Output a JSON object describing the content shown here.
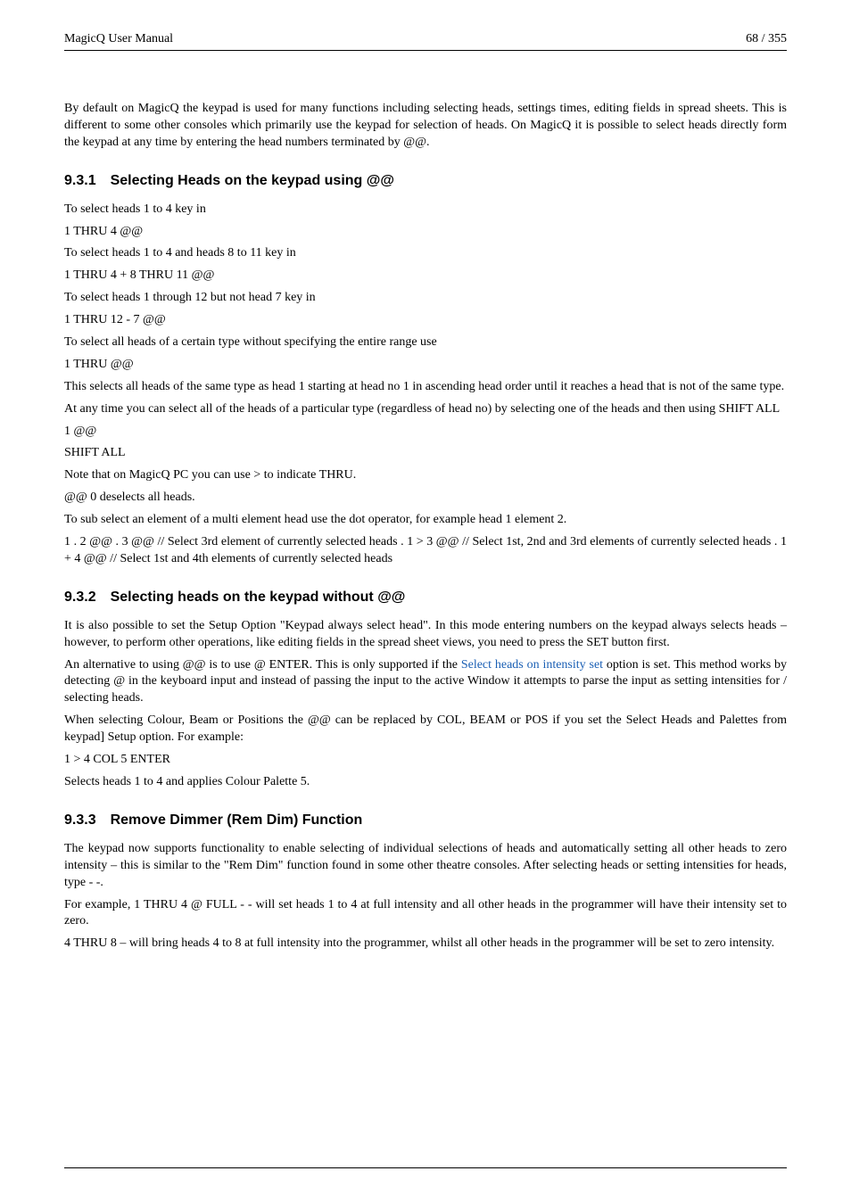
{
  "header": {
    "left": "MagicQ User Manual",
    "right": "68 / 355"
  },
  "intro": "By default on MagicQ the keypad is used for many functions including selecting heads, settings times, editing fields in spread sheets. This is different to some other consoles which primarily use the keypad for selection of heads. On MagicQ it is possible to select heads directly form the keypad at any time by entering the head numbers terminated by @@.",
  "s931": {
    "heading": "9.3.1 Selecting Heads on the keypad using @@",
    "p1": "To select heads 1 to 4 key in",
    "p2": "1 THRU 4 @@",
    "p3": "To select heads 1 to 4 and heads 8 to 11 key in",
    "p4": "1 THRU 4 + 8 THRU 11 @@",
    "p5": "To select heads 1 through 12 but not head 7 key in",
    "p6": "1 THRU 12 - 7 @@",
    "p7": "To select all heads of a certain type without specifying the entire range use",
    "p8": "1 THRU @@",
    "p9": "This selects all heads of the same type as head 1 starting at head no 1 in ascending head order until it reaches a head that is not of the same type.",
    "p10": "At any time you can select all of the heads of a particular type (regardless of head no) by selecting one of the heads and then using SHIFT ALL",
    "p11": "1 @@",
    "p12": "SHIFT ALL",
    "p13": "Note that on MagicQ PC you can use > to indicate THRU.",
    "p14": "@@ 0 deselects all heads.",
    "p15": "To sub select an element of a multi element head use the dot operator, for example head 1 element 2.",
    "p16": "1 . 2 @@ . 3 @@ // Select 3rd element of currently selected heads . 1 > 3 @@ // Select 1st, 2nd and 3rd elements of currently selected heads . 1 + 4 @@ // Select 1st and 4th elements of currently selected heads"
  },
  "s932": {
    "heading": "9.3.2 Selecting heads on the keypad without @@",
    "p1": "It is also possible to set the Setup Option \"Keypad always select head\". In this mode entering numbers on the keypad always selects heads – however, to perform other operations, like editing fields in the spread sheet views, you need to press the SET button first.",
    "p2a": "An alternative to using @@ is to use @ ENTER. This is only supported if the ",
    "p2link": "Select heads on intensity set",
    "p2b": " option is set. This method works by detecting @ in the keyboard input and instead of passing the input to the active Window it attempts to parse the input as setting intensities for / selecting heads.",
    "p3": "When selecting Colour, Beam or Positions the @@ can be replaced by COL, BEAM or POS if you set the Select Heads and Palettes from keypad] Setup option. For example:",
    "p4": "1 > 4 COL 5 ENTER",
    "p5": "Selects heads 1 to 4 and applies Colour Palette 5."
  },
  "s933": {
    "heading": "9.3.3 Remove Dimmer (Rem Dim) Function",
    "p1": "The keypad now supports functionality to enable selecting of individual selections of heads and automatically setting all other heads to zero intensity – this is similar to the \"Rem Dim\" function found in some other theatre consoles. After selecting heads or setting intensities for heads, type - -.",
    "p2": "For example, 1 THRU 4 @ FULL - - will set heads 1 to 4 at full intensity and all other heads in the programmer will have their intensity set to zero.",
    "p3": "4 THRU 8 – will bring heads 4 to 8 at full intensity into the programmer, whilst all other heads in the programmer will be set to zero intensity."
  }
}
